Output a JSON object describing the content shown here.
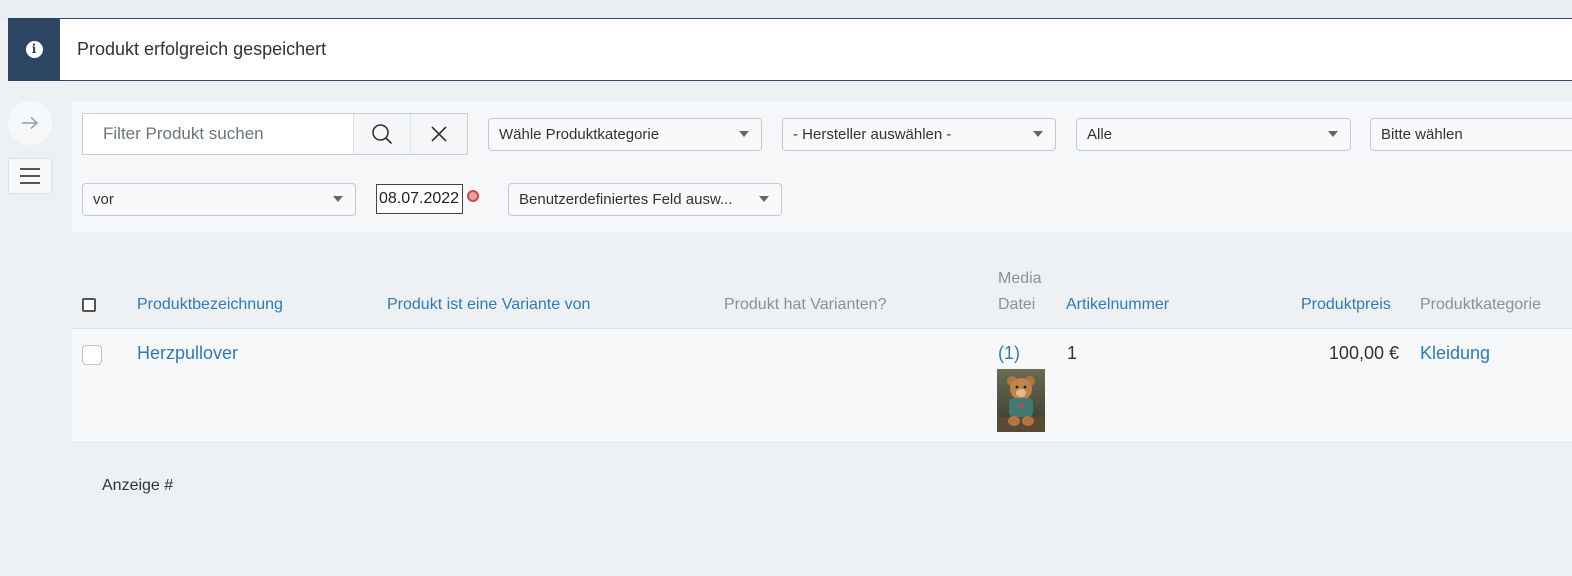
{
  "alert": {
    "icon": "info-icon",
    "message": "Produkt erfolgreich gespeichert",
    "accent_color": "#2b4563"
  },
  "sidebar": {
    "toggle_icon": "arrow-right-icon",
    "menu_icon": "hamburger-menu-icon"
  },
  "filters": {
    "search": {
      "placeholder": "Filter Produkt suchen",
      "value": ""
    },
    "category_select": "Wähle Produktkategorie",
    "manufacturer_select": "- Hersteller auswählen -",
    "status_select": "Alle",
    "extra_select": "Bitte wählen",
    "date_operator_select": "vor",
    "date_value": "08.07.2022",
    "custom_field_select": "Benutzerdefiniertes Feld ausw..."
  },
  "table": {
    "headers": {
      "name": "Produktbezeichnung",
      "variant_of": "Produkt ist eine Variante von",
      "has_variants": "Produkt hat Varianten?",
      "media_line1": "Media",
      "media_line2": "Datei",
      "sku": "Artikelnummer",
      "price": "Produktpreis",
      "category": "Produktkategorie"
    },
    "rows": [
      {
        "name": "Herzpullover",
        "variant_of": "",
        "has_variants": "",
        "media_count": "(1)",
        "sku": "1",
        "price": "100,00 €",
        "category": "Kleidung"
      }
    ]
  },
  "footer": {
    "display_label": "Anzeige #"
  },
  "colors": {
    "link": "#2f7ab8",
    "background": "#eef1f4"
  }
}
